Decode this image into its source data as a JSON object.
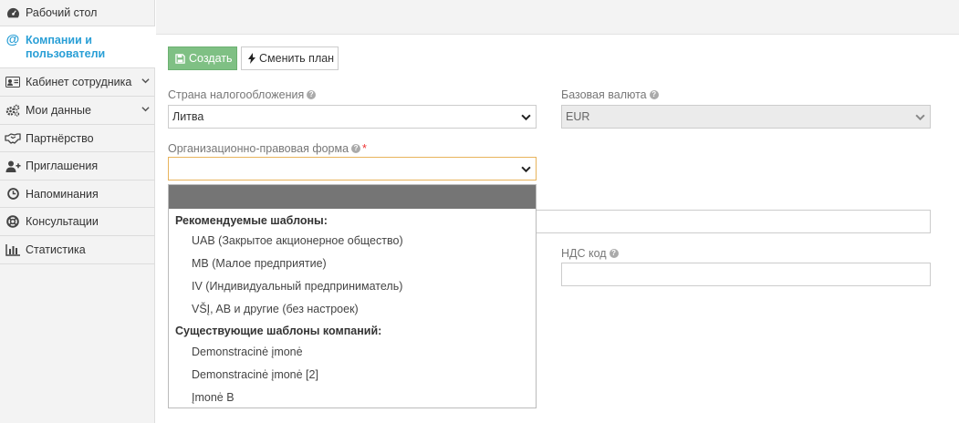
{
  "sidebar": {
    "items": [
      {
        "label": "Рабочий стол",
        "icon": "dashboard-icon"
      },
      {
        "label": "Компании и пользователи",
        "icon": "at-icon"
      },
      {
        "label": "Кабинет сотрудника",
        "icon": "id-card-icon"
      },
      {
        "label": "Мои данные",
        "icon": "gears-icon"
      },
      {
        "label": "Партнёрство",
        "icon": "handshake-icon"
      },
      {
        "label": "Приглашения",
        "icon": "add-user-icon"
      },
      {
        "label": "Напоминания",
        "icon": "clock-icon"
      },
      {
        "label": "Консультации",
        "icon": "lifebuoy-icon"
      },
      {
        "label": "Статистика",
        "icon": "bar-chart-icon"
      }
    ],
    "active_item": "Компании и пользователи"
  },
  "toolbar": {
    "create_label": "Создать",
    "change_plan_label": "Сменить план"
  },
  "form": {
    "tax_country": {
      "label": "Страна налогообложения",
      "value": "Литва"
    },
    "base_currency": {
      "label": "Базовая валюта",
      "value": "EUR"
    },
    "legal_form": {
      "label": "Организационно-правовая форма",
      "required_mark": "*",
      "value": ""
    },
    "vat_code": {
      "label": "НДС код",
      "value": ""
    }
  },
  "dropdown": {
    "groups": [
      {
        "label": "Рекомендуемые шаблоны:",
        "options": [
          "UAB (Закрытое акционерное общество)",
          "MB (Малое предприятие)",
          "IV (Индивидуальный предприниматель)",
          "VŠĮ, AB и другие (без настроек)"
        ]
      },
      {
        "label": "Существующие шаблоны компаний:",
        "options": [
          "Demonstracinė įmonė",
          "Demonstracinė įmonė [2]",
          "Įmonė B"
        ]
      }
    ]
  },
  "colors": {
    "accent": "#2a9fd6",
    "create_button": "#7fc084",
    "focus_border": "#e8b45c",
    "dropdown_header": "#757575",
    "required": "#ee3333"
  }
}
